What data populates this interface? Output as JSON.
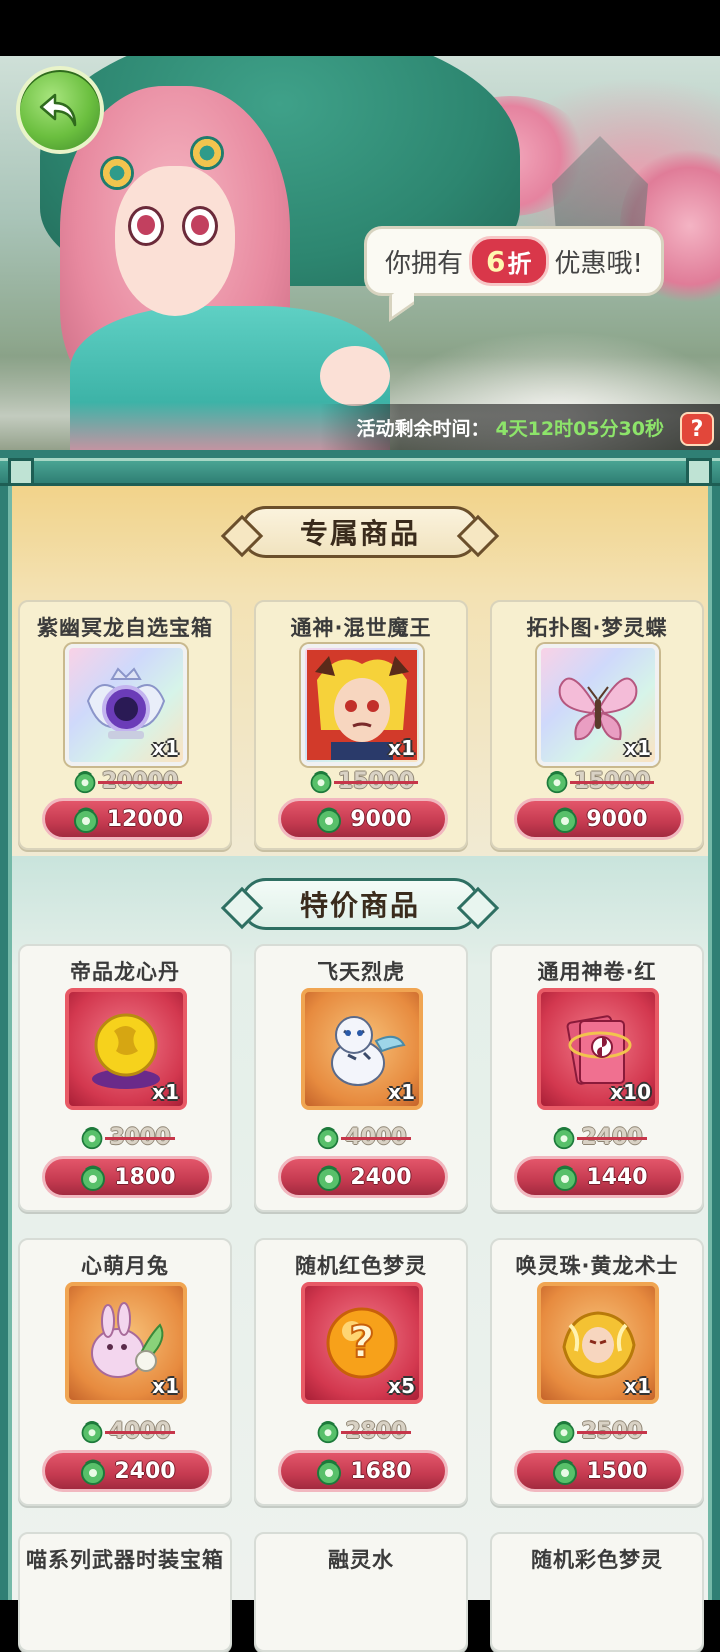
{
  "banner": {
    "bubble_prefix": "你拥有",
    "discount_number": "6",
    "discount_unit": "折",
    "bubble_suffix": "优惠哦!",
    "timer_label": "活动剩余时间：",
    "timer_value": "4天12时05分30秒",
    "help_label": "?"
  },
  "sections": {
    "exclusive_title": "专属商品",
    "special_title": "特价商品"
  },
  "exclusive_items": [
    {
      "name": "紫幽冥龙自选宝箱",
      "qty": "x1",
      "old_price": "20000",
      "price": "12000",
      "icon": "treasure-chest-icon"
    },
    {
      "name": "通神·混世魔王",
      "qty": "x1",
      "old_price": "15000",
      "price": "9000",
      "icon": "demon-king-portrait-icon"
    },
    {
      "name": "拓扑图·梦灵蝶",
      "qty": "x1",
      "old_price": "15000",
      "price": "9000",
      "icon": "butterfly-icon"
    }
  ],
  "special_items": [
    {
      "name": "帝品龙心丹",
      "qty": "x1",
      "old_price": "3000",
      "price": "1800",
      "icon": "dragon-orb-icon"
    },
    {
      "name": "飞天烈虎",
      "qty": "x1",
      "old_price": "4000",
      "price": "2400",
      "icon": "white-tiger-icon"
    },
    {
      "name": "通用神卷·红",
      "qty": "x10",
      "old_price": "2400",
      "price": "1440",
      "icon": "red-scroll-icon"
    },
    {
      "name": "心萌月兔",
      "qty": "x1",
      "old_price": "4000",
      "price": "2400",
      "icon": "moon-rabbit-icon"
    },
    {
      "name": "随机红色梦灵",
      "qty": "x5",
      "old_price": "2800",
      "price": "1680",
      "icon": "mystery-orb-icon"
    },
    {
      "name": "唤灵珠·黄龙术士",
      "qty": "x1",
      "old_price": "2500",
      "price": "1500",
      "icon": "golden-dragon-icon"
    }
  ],
  "partial_items": [
    {
      "name": "喵系列武器时装宝箱"
    },
    {
      "name": "融灵水"
    },
    {
      "name": "随机彩色梦灵"
    }
  ],
  "colors": {
    "frame": "#2f7f74",
    "price_button": "#c53a50",
    "timer_value": "#8de46a",
    "gem": "#58c06a"
  }
}
